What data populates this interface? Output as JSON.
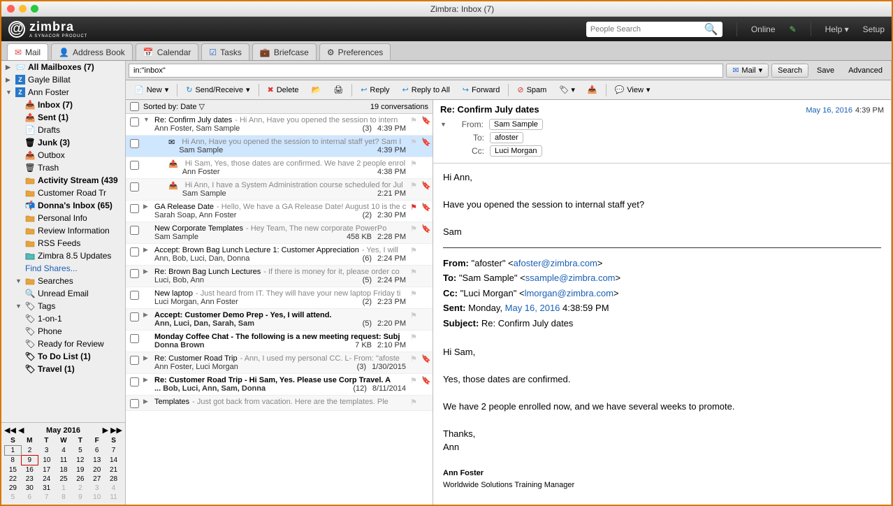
{
  "window_title": "Zimbra: Inbox (7)",
  "brand": "zimbra",
  "brand_sub": "A SYNACOR PRODUCT",
  "header": {
    "people_search_placeholder": "People Search",
    "online": "Online",
    "help": "Help",
    "setup": "Setup"
  },
  "tabs": [
    {
      "label": "Mail",
      "active": true
    },
    {
      "label": "Address Book",
      "active": false
    },
    {
      "label": "Calendar",
      "active": false
    },
    {
      "label": "Tasks",
      "active": false
    },
    {
      "label": "Briefcase",
      "active": false
    },
    {
      "label": "Preferences",
      "active": false
    }
  ],
  "sidebar": {
    "all_mailboxes": "All Mailboxes (7)",
    "gayle": "Gayle Billat",
    "ann": "Ann Foster",
    "folders": [
      {
        "label": "Inbox (7)",
        "bold": true,
        "ic": "inbox"
      },
      {
        "label": "Sent (1)",
        "bold": true,
        "ic": "sent"
      },
      {
        "label": "Drafts",
        "bold": false,
        "ic": "drafts"
      },
      {
        "label": "Junk (3)",
        "bold": true,
        "ic": "junk"
      },
      {
        "label": "Outbox",
        "bold": false,
        "ic": "outbox"
      },
      {
        "label": "Trash",
        "bold": false,
        "ic": "trash"
      },
      {
        "label": "Activity Stream (439",
        "bold": true,
        "ic": "folder"
      },
      {
        "label": "Customer Road Tr",
        "bold": false,
        "ic": "folder"
      },
      {
        "label": "Donna's Inbox (65)",
        "bold": true,
        "ic": "share"
      },
      {
        "label": "Personal Info",
        "bold": false,
        "ic": "folder"
      },
      {
        "label": "Review Information",
        "bold": false,
        "ic": "folder"
      },
      {
        "label": "RSS Feeds",
        "bold": false,
        "ic": "folder"
      },
      {
        "label": "Zimbra 8.5 Updates",
        "bold": false,
        "ic": "folderb"
      }
    ],
    "find_shares": "Find Shares...",
    "searches": "Searches",
    "unread": "Unread Email",
    "tags": "Tags",
    "tag_items": [
      {
        "label": "1-on-1",
        "bold": false
      },
      {
        "label": "Phone",
        "bold": false
      },
      {
        "label": "Ready for Review",
        "bold": false
      },
      {
        "label": "To Do List (1)",
        "bold": true
      },
      {
        "label": "Travel (1)",
        "bold": true
      }
    ]
  },
  "calendar": {
    "month": "May 2016",
    "dow": [
      "S",
      "M",
      "T",
      "W",
      "T",
      "F",
      "S"
    ],
    "weeks": [
      [
        "1",
        "2",
        "3",
        "4",
        "5",
        "6",
        "7"
      ],
      [
        "8",
        "9",
        "10",
        "11",
        "12",
        "13",
        "14"
      ],
      [
        "15",
        "16",
        "17",
        "18",
        "19",
        "20",
        "21"
      ],
      [
        "22",
        "23",
        "24",
        "25",
        "26",
        "27",
        "28"
      ],
      [
        "29",
        "30",
        "31",
        "1",
        "2",
        "3",
        "4"
      ],
      [
        "5",
        "6",
        "7",
        "8",
        "9",
        "10",
        "11"
      ]
    ],
    "today_row": 1,
    "today_col": 1,
    "gray_start": [
      4,
      3
    ]
  },
  "search": {
    "input": "in:\"inbox\"",
    "mail_btn": "Mail",
    "search_btn": "Search",
    "save_btn": "Save",
    "advanced_btn": "Advanced"
  },
  "toolbar": {
    "new": "New",
    "sendrecv": "Send/Receive",
    "delete": "Delete",
    "reply": "Reply",
    "replyall": "Reply to All",
    "forward": "Forward",
    "spam": "Spam",
    "view": "View"
  },
  "list": {
    "sorted_by": "Sorted by: Date",
    "count": "19 conversations",
    "items": [
      {
        "exp": "▼",
        "subject": "Re: Confirm July dates",
        "preview": " - Hi Ann, Have you opened the session to intern",
        "senders": "Ann Foster, Sam Sample",
        "count": "(3)",
        "time": "4:39 PM",
        "tag": true,
        "bold": false,
        "sel": false,
        "indent": false
      },
      {
        "exp": "",
        "ic": "mail",
        "subject": "",
        "preview": "Hi Ann, Have you opened the session to internal staff yet? Sam I",
        "senders": "Sam Sample",
        "count": "",
        "time": "4:39 PM",
        "tag": true,
        "bold": false,
        "sel": true,
        "indent": true
      },
      {
        "exp": "",
        "ic": "sent",
        "subject": "",
        "preview": "Hi Sam, Yes, those dates are confirmed. We have 2 people enrol",
        "senders": "Ann Foster",
        "count": "",
        "time": "4:38 PM",
        "tag": false,
        "bold": false,
        "sel": false,
        "indent": true
      },
      {
        "exp": "",
        "ic": "sent",
        "subject": "",
        "preview": "Hi Ann, I have a System Administration course scheduled for Jul",
        "senders": "Sam Sample",
        "count": "",
        "time": "2:21 PM",
        "tag": true,
        "bold": false,
        "sel": false,
        "indent": true
      },
      {
        "exp": "▶",
        "subject": "GA Release Date",
        "preview": " - Hello, We have a GA Release Date! August 10 is the c",
        "senders": "Sarah Soap, Ann Foster",
        "count": "(2)",
        "time": "2:30 PM",
        "tag": true,
        "flag": "red",
        "bold": false
      },
      {
        "exp": "",
        "subject": "New Corporate Templates",
        "preview": " - Hey Team, The new corporate PowerPo",
        "senders": "Sam Sample",
        "count": "458 KB",
        "time": "2:28 PM",
        "tag": true,
        "attach": true,
        "bold": false
      },
      {
        "exp": "▶",
        "subject": "Accept: Brown Bag Lunch Lecture 1: Customer Appreciation",
        "preview": " - Yes, I will",
        "senders": "Ann, Bob, Luci, Dan, Donna",
        "count": "(6)",
        "time": "2:24 PM",
        "tag": false,
        "bold": false
      },
      {
        "exp": "▶",
        "subject": "Re: Brown Bag Lunch Lectures",
        "preview": " - If there is money for it, please order co",
        "senders": "Luci, Bob, Ann",
        "count": "(5)",
        "time": "2:24 PM",
        "tag": false,
        "bold": false
      },
      {
        "exp": "",
        "subject": "New laptop",
        "preview": " - Just heard from IT. They will have your new laptop Friday ti",
        "senders": "Luci Morgan, Ann Foster",
        "count": "(2)",
        "time": "2:23 PM",
        "tag": false,
        "bold": false
      },
      {
        "exp": "▶",
        "subject": "Accept: Customer Demo Prep - Yes, I will attend.",
        "preview": "",
        "senders": "Ann, Luci, Dan, Sarah, Sam",
        "count": "(5)",
        "time": "2:20 PM",
        "tag": false,
        "bold": true
      },
      {
        "exp": "",
        "subject": "Monday Coffee Chat - The following is a new meeting request: Subj",
        "preview": "",
        "senders": "Donna Brown",
        "count": "7 KB",
        "time": "2:10 PM",
        "tag": false,
        "bold": true
      },
      {
        "exp": "▶",
        "subject": "Re: Customer Road Trip",
        "preview": " - Ann, I used my personal CC. L- From: \"afoste",
        "senders": "Ann Foster, Luci Morgan",
        "count": "(3)",
        "time": "1/30/2015",
        "tag": true,
        "bold": false
      },
      {
        "exp": "▶",
        "subject": "Re: Customer Road Trip - Hi Sam, Yes. Please use Corp Travel. A",
        "preview": "",
        "senders": "... Bob, Luci, Ann, Sam, Donna",
        "count": "(12)",
        "time": "8/11/2014",
        "tag": true,
        "attach": true,
        "bold": true
      },
      {
        "exp": "▶",
        "subject": "Templates",
        "preview": " - Just got back from vacation. Here are the templates. Ple",
        "senders": "",
        "count": "",
        "time": "",
        "tag": false,
        "bold": false
      }
    ]
  },
  "reader": {
    "subject": "Re: Confirm July dates",
    "date": "May 16, 2016",
    "time": "4:39 PM",
    "from_label": "From:",
    "from": "Sam Sample",
    "to_label": "To:",
    "to": "afoster",
    "cc_label": "Cc:",
    "cc": "Luci Morgan",
    "body_lines": [
      "Hi Ann,",
      "",
      "Have you opened the session to internal staff yet?",
      "",
      "Sam"
    ],
    "quoted": {
      "from_l": "From:",
      "from": "\"afoster\" <",
      "from_e": "afoster@zimbra.com",
      "from_end": ">",
      "to_l": "To:",
      "to": "\"Sam Sample\" <",
      "to_e": "ssample@zimbra.com",
      "to_end": ">",
      "cc_l": "Cc:",
      "cc": "\"Luci Morgan\" <",
      "cc_e": "lmorgan@zimbra.com",
      "cc_end": ">",
      "sent_l": "Sent:",
      "sent": "Monday, ",
      "sent_d": "May 16, 2016",
      "sent_t": " 4:38:59 PM",
      "subj_l": "Subject:",
      "subj": "Re: Confirm July dates"
    },
    "reply_lines": [
      "Hi Sam,",
      "",
      "Yes, those dates are confirmed.",
      "",
      "We have 2 people enrolled now, and we have several weeks to promote.",
      "",
      "Thanks,",
      "Ann"
    ],
    "sig_name": "Ann Foster",
    "sig_title": "Worldwide Solutions Training Manager"
  }
}
